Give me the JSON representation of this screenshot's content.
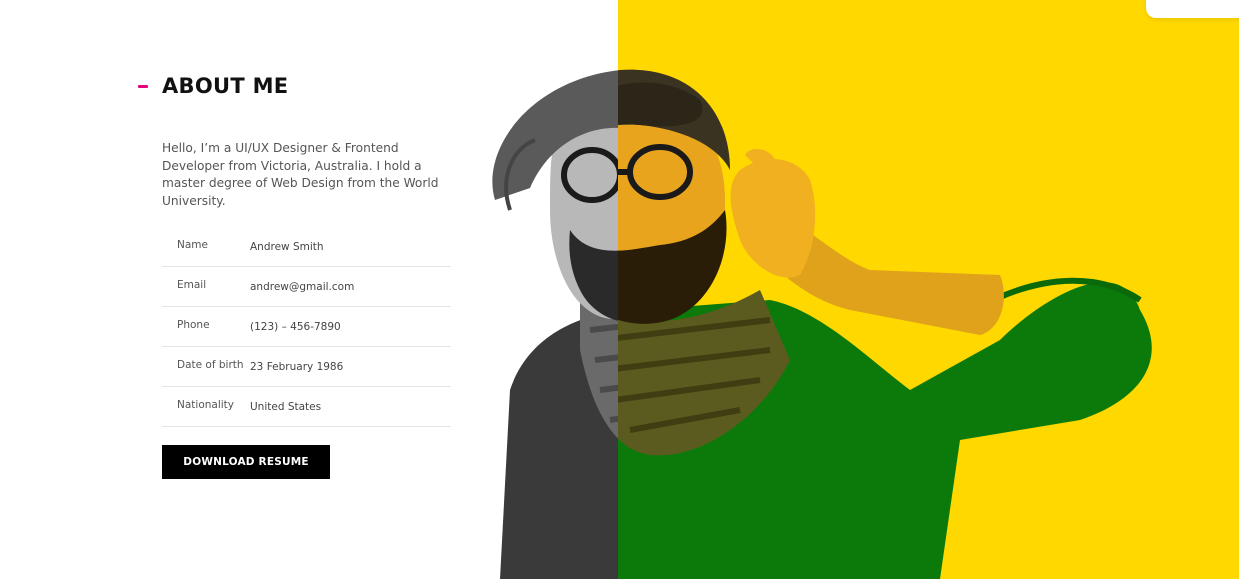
{
  "about": {
    "heading": "ABOUT ME",
    "intro": "Hello, I’m a UI/UX Designer & Frontend Developer from Victoria, Australia. I hold a master degree of Web Design from the World University.",
    "details": [
      {
        "label": "Name",
        "value": "Andrew Smith"
      },
      {
        "label": "Email",
        "value": "andrew@gmail.com"
      },
      {
        "label": "Phone",
        "value": "(123) – 456-7890"
      },
      {
        "label": "Date of birth",
        "value": "23 February 1986"
      },
      {
        "label": "Nationality",
        "value": "United States"
      }
    ],
    "button_label": "DOWNLOAD RESUME"
  },
  "colors": {
    "accent": "#E6007E",
    "panel": "#FFD800",
    "sweater": "#0B7A0B",
    "button": "#000000"
  },
  "image": {
    "subject": "portrait-photo"
  }
}
